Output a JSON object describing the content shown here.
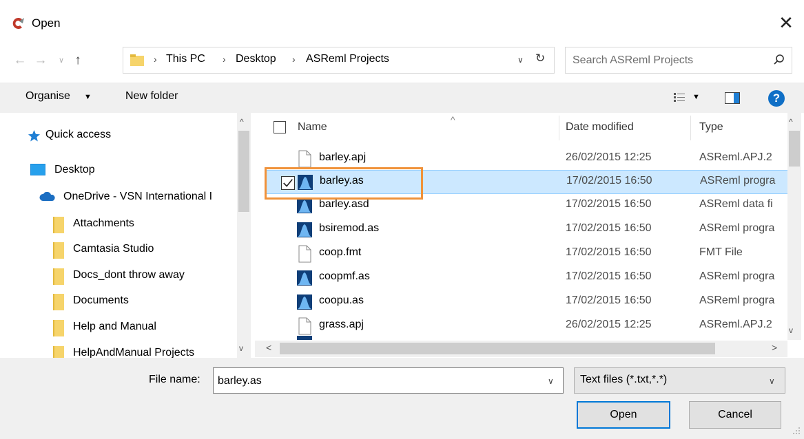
{
  "window": {
    "title": "Open",
    "close_glyph": "✕"
  },
  "nav": {
    "back_glyph": "←",
    "forward_glyph": "→",
    "recent_glyph": "∨",
    "up_glyph": "↑"
  },
  "address": {
    "crumbs": [
      "This PC",
      "Desktop",
      "ASReml Projects"
    ],
    "separator": "›",
    "dropdown_glyph": "∨",
    "refresh_glyph": "↻"
  },
  "search": {
    "placeholder": "Search ASReml Projects"
  },
  "toolbar": {
    "organise_label": "Organise",
    "organise_arrow": "▼",
    "new_folder_label": "New folder",
    "view_arrow": "▼",
    "help_glyph": "?"
  },
  "sidebar": {
    "items": [
      {
        "label": "Quick access",
        "icon": "star-icon"
      },
      {
        "label": "Desktop",
        "icon": "desktop-icon"
      },
      {
        "label": "OneDrive - VSN International I",
        "icon": "cloud-icon"
      },
      {
        "label": "Attachments",
        "icon": "folder-icon"
      },
      {
        "label": "Camtasia Studio",
        "icon": "folder-icon"
      },
      {
        "label": "Docs_dont throw away",
        "icon": "folder-icon"
      },
      {
        "label": "Documents",
        "icon": "folder-icon"
      },
      {
        "label": "Help and Manual",
        "icon": "folder-icon"
      },
      {
        "label": "HelpAndManual Projects",
        "icon": "folder-icon"
      }
    ],
    "scroll_up": "^",
    "scroll_down": "v"
  },
  "filelist": {
    "columns": {
      "name": "Name",
      "date": "Date modified",
      "type": "Type"
    },
    "sort_glyph": "^",
    "rows": [
      {
        "name": "barley.apj",
        "date": "26/02/2015 12:25",
        "type": "ASReml.APJ.2",
        "icon": "document-icon",
        "selected": false
      },
      {
        "name": "barley.as",
        "date": "17/02/2015 16:50",
        "type": "ASReml progra",
        "icon": "asreml-icon",
        "selected": true
      },
      {
        "name": "barley.asd",
        "date": "17/02/2015 16:50",
        "type": "ASReml data fi",
        "icon": "asreml-icon",
        "selected": false
      },
      {
        "name": "bsiremod.as",
        "date": "17/02/2015 16:50",
        "type": "ASReml progra",
        "icon": "asreml-icon",
        "selected": false
      },
      {
        "name": "coop.fmt",
        "date": "17/02/2015 16:50",
        "type": "FMT File",
        "icon": "document-icon",
        "selected": false
      },
      {
        "name": "coopmf.as",
        "date": "17/02/2015 16:50",
        "type": "ASReml progra",
        "icon": "asreml-icon",
        "selected": false
      },
      {
        "name": "coopu.as",
        "date": "17/02/2015 16:50",
        "type": "ASReml progra",
        "icon": "asreml-icon",
        "selected": false
      },
      {
        "name": "grass.apj",
        "date": "26/02/2015 12:25",
        "type": "ASReml.APJ.2",
        "icon": "document-icon",
        "selected": false
      }
    ],
    "scroll_up": "^",
    "scroll_down": "v",
    "scroll_left": "<",
    "scroll_right": ">"
  },
  "footer": {
    "file_name_label": "File name:",
    "file_name_value": "barley.as",
    "file_name_dd": "∨",
    "file_type_value": "Text files (*.txt,*.*)",
    "file_type_dd": "∨",
    "open_label": "Open",
    "cancel_label": "Cancel"
  },
  "colors": {
    "selection_bg": "#cce8ff",
    "highlight_box": "#f0923a",
    "accent": "#0078d7"
  }
}
